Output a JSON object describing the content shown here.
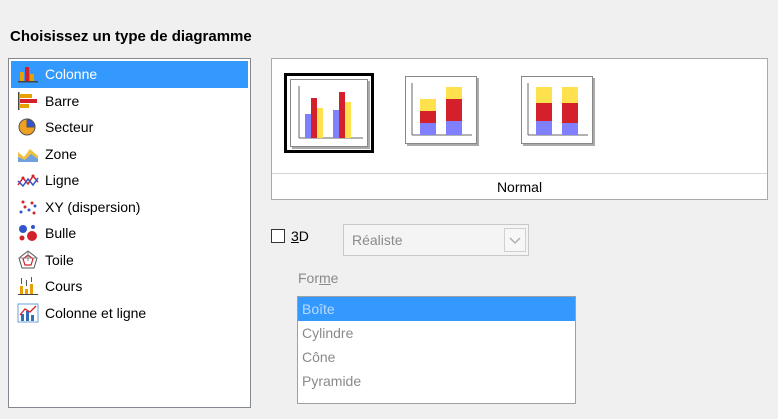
{
  "heading": "Choisissez un type de diagramme",
  "chart_types": [
    {
      "label": "Colonne",
      "icon": "column-chart-icon",
      "selected": true
    },
    {
      "label": "Barre",
      "icon": "bar-chart-icon",
      "selected": false
    },
    {
      "label": "Secteur",
      "icon": "pie-chart-icon",
      "selected": false
    },
    {
      "label": "Zone",
      "icon": "area-chart-icon",
      "selected": false
    },
    {
      "label": "Ligne",
      "icon": "line-chart-icon",
      "selected": false
    },
    {
      "label": "XY (dispersion)",
      "icon": "scatter-chart-icon",
      "selected": false
    },
    {
      "label": "Bulle",
      "icon": "bubble-chart-icon",
      "selected": false
    },
    {
      "label": "Toile",
      "icon": "net-chart-icon",
      "selected": false
    },
    {
      "label": "Cours",
      "icon": "stock-chart-icon",
      "selected": false
    },
    {
      "label": "Colonne et ligne",
      "icon": "column-line-chart-icon",
      "selected": false
    }
  ],
  "variants": {
    "caption": "Normal",
    "items": [
      {
        "name": "normal-variant",
        "selected": true
      },
      {
        "name": "stacked-variant",
        "selected": false
      },
      {
        "name": "percent-stacked-variant",
        "selected": false
      }
    ]
  },
  "three_d": {
    "label": "3D",
    "mnemonic": "3",
    "checked": false,
    "combo_value": "Réaliste"
  },
  "shape": {
    "label": "Forme",
    "options": [
      "Boîte",
      "Cylindre",
      "Cône",
      "Pyramide"
    ],
    "selected": "Boîte"
  },
  "colors": {
    "selection": "#3399ff",
    "bar_blue": "#8080ff",
    "bar_red": "#d4202a",
    "bar_yellow": "#ffe14d"
  }
}
